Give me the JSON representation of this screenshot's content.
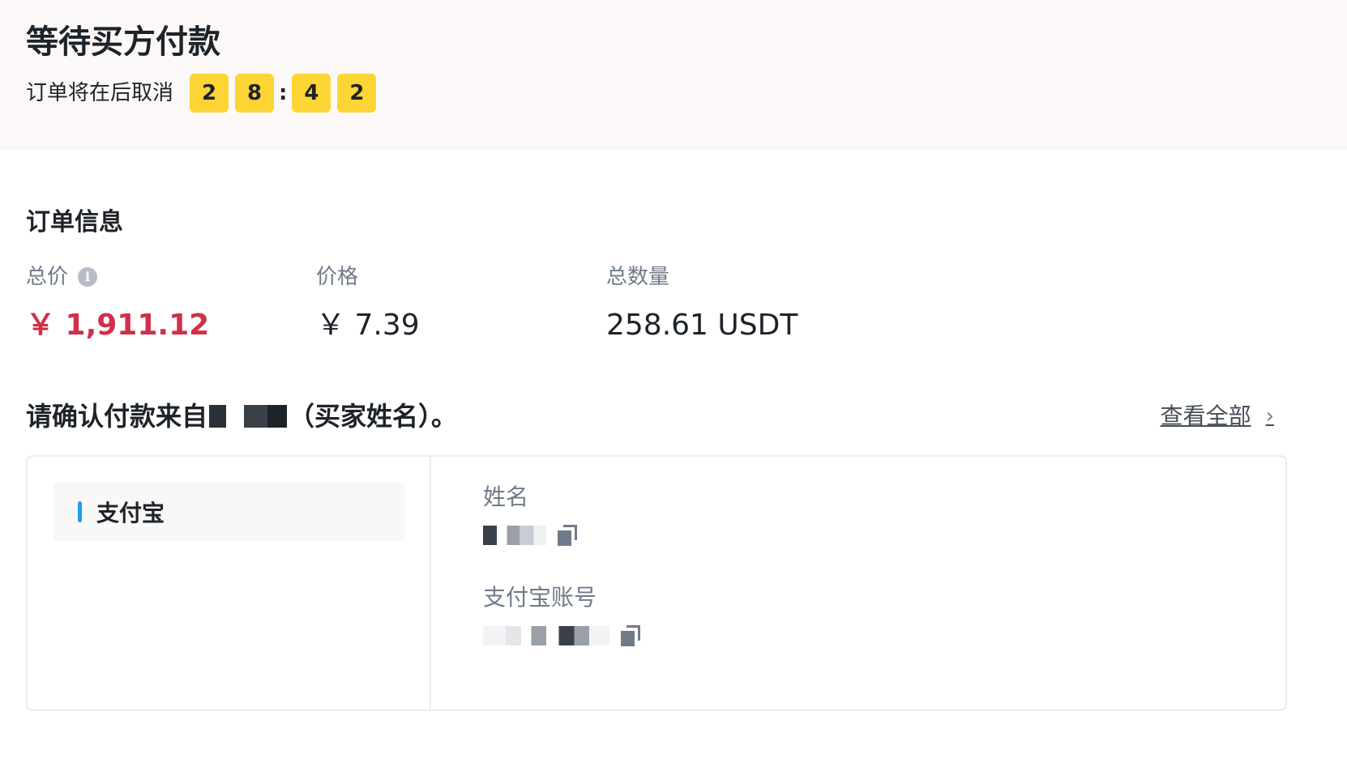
{
  "header": {
    "title": "等待买方付款",
    "countdown_label": "订单将在后取消",
    "countdown": {
      "d1": "2",
      "d2": "8",
      "separator": ":",
      "d3": "4",
      "d4": "2"
    }
  },
  "order_info": {
    "title": "订单信息",
    "total": {
      "label": "总价",
      "value": "￥ 1,911.12"
    },
    "price": {
      "label": "价格",
      "value": "￥ 7.39"
    },
    "quantity": {
      "label": "总数量",
      "value": "258.61 USDT"
    }
  },
  "confirm": {
    "prefix": "请确认付款来自",
    "suffix": "（买家姓名）。",
    "view_all": "查看全部"
  },
  "payment": {
    "method": "支付宝",
    "name_label": "姓名",
    "account_label": "支付宝账号"
  },
  "colors": {
    "accent_yellow": "#fcd535",
    "total_red": "#cf304a",
    "alipay_blue": "#1a9dff",
    "header_bg": "#fdf8f8"
  },
  "icons": [
    "info-icon",
    "chevron-right-icon",
    "copy-icon"
  ]
}
